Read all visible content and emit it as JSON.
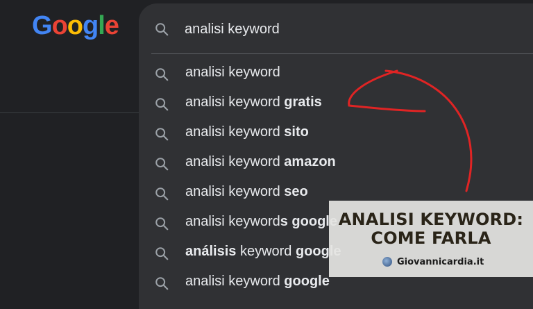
{
  "colors": {
    "background": "#202124",
    "panel": "#303134",
    "text": "#e8eaed",
    "icon": "#9aa0a6",
    "arrow": "#e02424",
    "overlay": "#e4e4e2"
  },
  "logo": {
    "text": "Google"
  },
  "search": {
    "value": "analisi keyword",
    "icon": "search-icon"
  },
  "suggestions": [
    {
      "base": "analisi keyword",
      "bold": ""
    },
    {
      "base": "analisi keyword ",
      "bold": "gratis"
    },
    {
      "base": "analisi keyword ",
      "bold": "sito"
    },
    {
      "base": "analisi keyword ",
      "bold": "amazon"
    },
    {
      "base": "analisi keyword ",
      "bold": "seo"
    },
    {
      "base": "analisi keyword",
      "bold": "s google"
    },
    {
      "bold_first": "análisis",
      "base": " keyword ",
      "bold": "google"
    },
    {
      "base": "analisi keyword ",
      "bold": "google"
    }
  ],
  "overlay": {
    "title_line1": "ANALISI KEYWORD:",
    "title_line2": "COME FARLA",
    "site": "Giovannicardia.it"
  }
}
